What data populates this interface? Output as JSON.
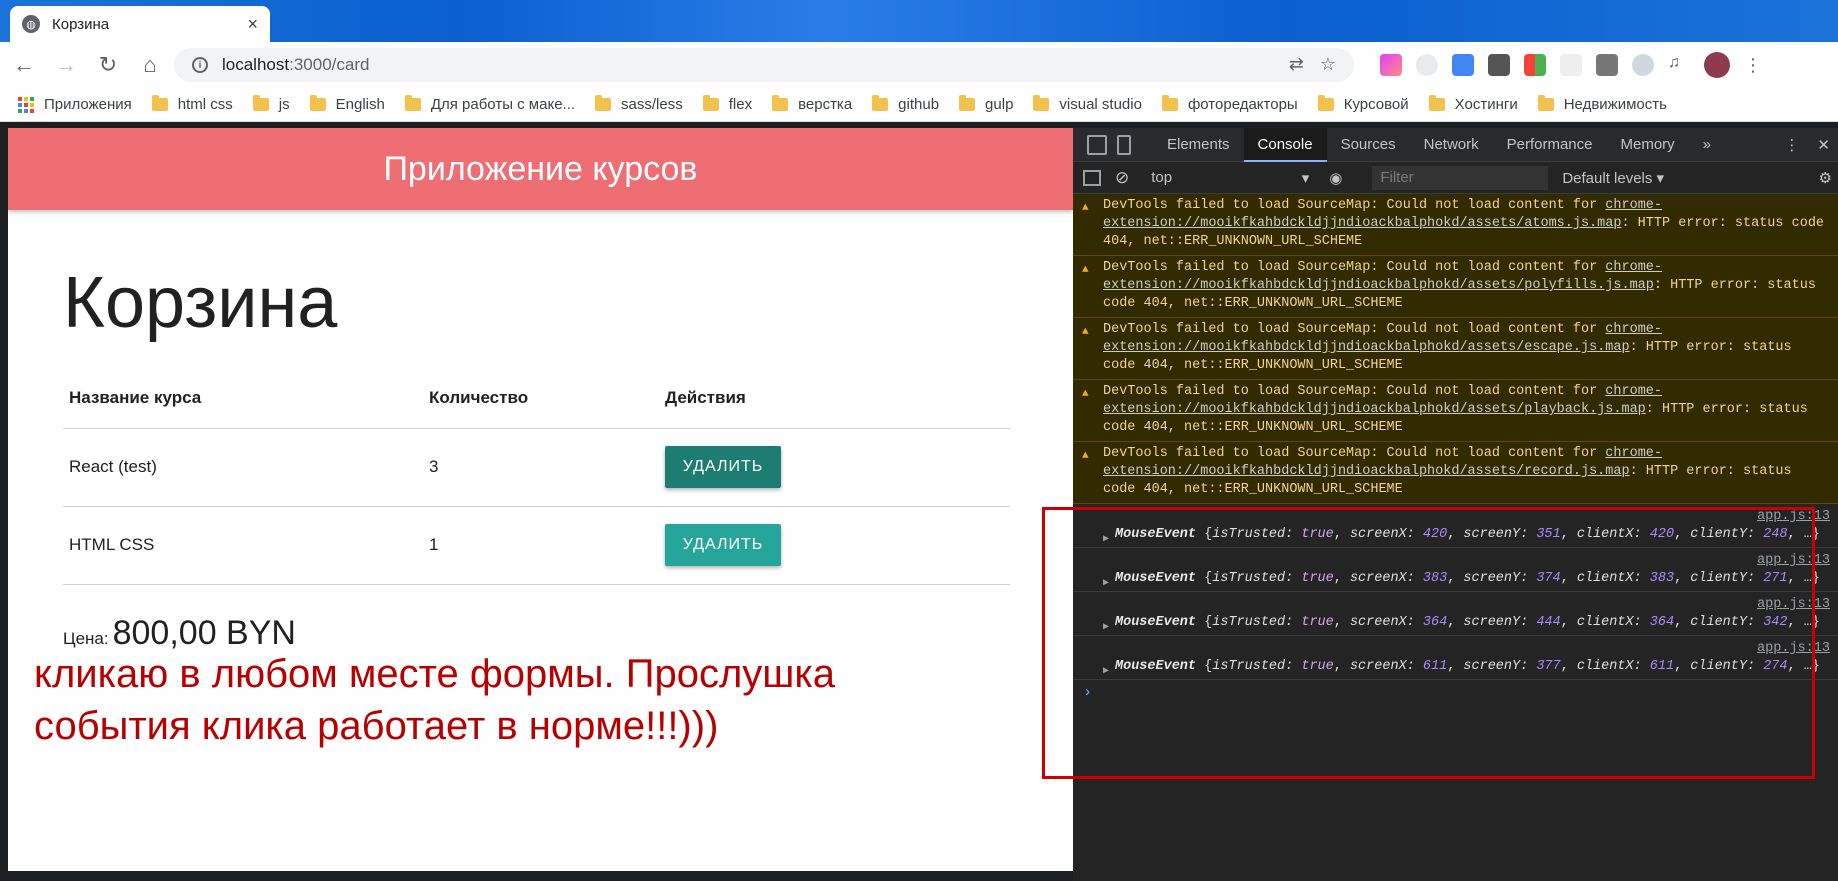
{
  "browser": {
    "tab_title": "Корзина",
    "tab_close": "×",
    "url_host": "localhost",
    "url_path": ":3000/card",
    "bookmarks": [
      "Приложения",
      "html css",
      "js",
      "English",
      "Для работы с маке...",
      "sass/less",
      "flex",
      "верстка",
      "github",
      "gulp",
      "visual studio",
      "фоторедакторы",
      "Курсовой",
      "Хостинги",
      "Недвижимость"
    ]
  },
  "page": {
    "brand": "Приложение курсов",
    "heading": "Корзина",
    "table": {
      "headers": [
        "Название курса",
        "Количество",
        "Действия"
      ],
      "rows": [
        {
          "name": "React (test)",
          "qty": "3",
          "action": "УДАЛИТЬ"
        },
        {
          "name": "HTML CSS",
          "qty": "1",
          "action": "УДАЛИТЬ"
        }
      ]
    },
    "price_label": "Цена:",
    "price_value": "800,00 BYN"
  },
  "annotation": {
    "line1": "кликаю в любом месте формы. Прослушка",
    "line2": "события клика работает в норме!!!)))"
  },
  "devtools": {
    "tabs": [
      "Elements",
      "Console",
      "Sources",
      "Network",
      "Performance",
      "Memory",
      "»"
    ],
    "active_tab": "Console",
    "context": "top",
    "filter_placeholder": "Filter",
    "levels": "Default levels ▾",
    "warnings": [
      {
        "prefix": "DevTools failed to load SourceMap: Could not load content for ",
        "link": "chrome-extension://mooikfkahbdckldjjndioackbalphokd/assets/atoms.js.map",
        "suffix": ": HTTP error: status code 404, net::ERR_UNKNOWN_URL_SCHEME"
      },
      {
        "prefix": "DevTools failed to load SourceMap: Could not load content for ",
        "link": "chrome-extension://mooikfkahbdckldjjndioackbalphokd/assets/polyfills.js.map",
        "suffix": ": HTTP error: status code 404, net::ERR_UNKNOWN_URL_SCHEME"
      },
      {
        "prefix": "DevTools failed to load SourceMap: Could not load content for ",
        "link": "chrome-extension://mooikfkahbdckldjjndioackbalphokd/assets/escape.js.map",
        "suffix": ": HTTP error: status code 404, net::ERR_UNKNOWN_URL_SCHEME"
      },
      {
        "prefix": "DevTools failed to load SourceMap: Could not load content for ",
        "link": "chrome-extension://mooikfkahbdckldjjndioackbalphokd/assets/playback.js.map",
        "suffix": ": HTTP error: status code 404, net::ERR_UNKNOWN_URL_SCHEME"
      },
      {
        "prefix": "DevTools failed to load SourceMap: Could not load content for ",
        "link": "chrome-extension://mooikfkahbdckldjjndioackbalphokd/assets/record.js.map",
        "suffix": ": HTTP error: status code 404, net::ERR_UNKNOWN_URL_SCHEME"
      }
    ],
    "events": [
      {
        "src": "app.js:13",
        "screenX": "420",
        "screenY": "351",
        "clientX": "420",
        "clientY": "248"
      },
      {
        "src": "app.js:13",
        "screenX": "383",
        "screenY": "374",
        "clientX": "383",
        "clientY": "271"
      },
      {
        "src": "app.js:13",
        "screenX": "364",
        "screenY": "444",
        "clientX": "364",
        "clientY": "342"
      },
      {
        "src": "app.js:13",
        "screenX": "611",
        "screenY": "377",
        "clientX": "611",
        "clientY": "274"
      }
    ],
    "prompt": "›"
  }
}
